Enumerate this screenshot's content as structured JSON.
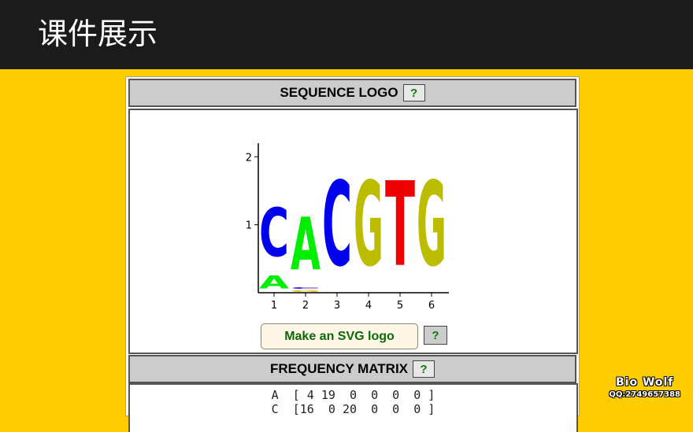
{
  "slide": {
    "title": "课件展示"
  },
  "sections": {
    "logo": {
      "title": "SEQUENCE LOGO",
      "help": "?"
    },
    "matrix": {
      "title": "FREQUENCY MATRIX",
      "help": "?"
    }
  },
  "logo_chart": {
    "y_ticks": [
      "1",
      "2"
    ],
    "x_ticks": [
      "1",
      "2",
      "3",
      "4",
      "5",
      "6"
    ],
    "letters": [
      {
        "letter": "A",
        "color": "#00ee00",
        "position": 1,
        "height": 0.3
      },
      {
        "letter": "C",
        "color": "#0000ee",
        "position": 1,
        "height": 1.15
      },
      {
        "letter": "G",
        "color": "#e0c000",
        "position": 2,
        "height": 0.05
      },
      {
        "letter": "C",
        "color": "#0000ee",
        "position": 2,
        "height": 0.04
      },
      {
        "letter": "A",
        "color": "#00ee00",
        "position": 2,
        "height": 1.25
      },
      {
        "letter": "C",
        "color": "#0000ee",
        "position": 3,
        "height": 2.0
      },
      {
        "letter": "G",
        "color": "#bcbc00",
        "position": 4,
        "height": 2.0
      },
      {
        "letter": "T",
        "color": "#ee0000",
        "position": 5,
        "height": 2.0
      },
      {
        "letter": "G",
        "color": "#bcbc00",
        "position": 6,
        "height": 2.0
      }
    ],
    "y_max": 2.2
  },
  "buttons": {
    "svg_logo": "Make an SVG logo",
    "svg_help": "?"
  },
  "matrix": {
    "row_a": "A  [ 4 19  0  0  0  0 ]",
    "row_c": "C  [16  0 20  0  0  0 ]"
  },
  "watermark": {
    "line1": "Bio  Wolf",
    "line2": "QQ:2749657388"
  }
}
